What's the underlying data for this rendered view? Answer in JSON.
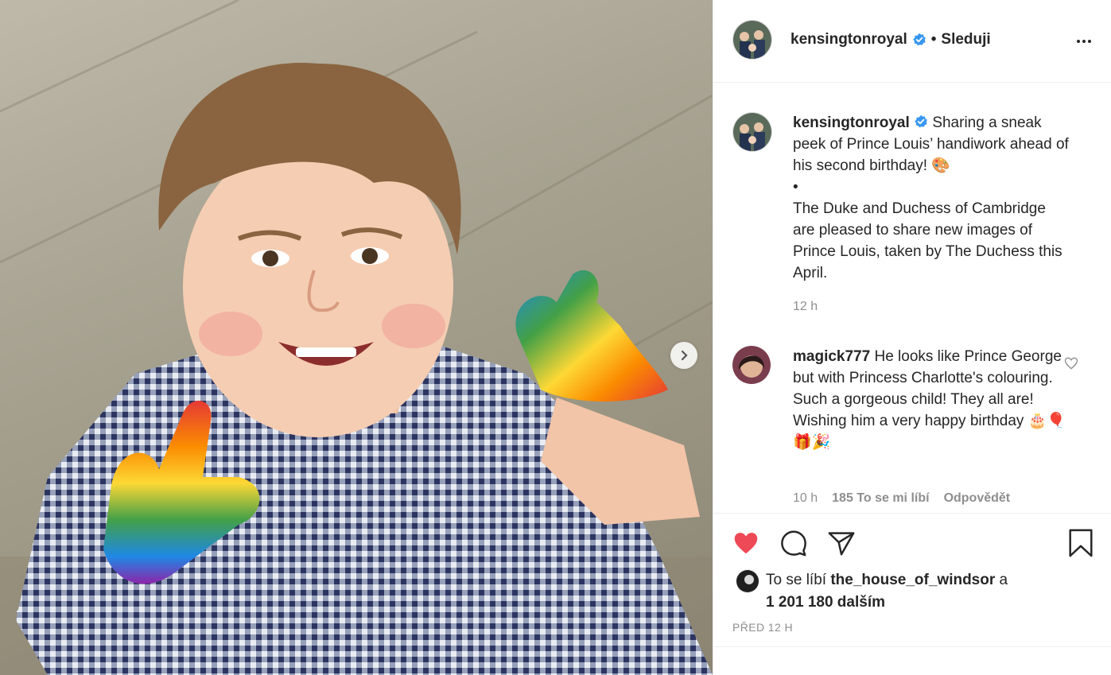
{
  "post": {
    "username": "kensingtonroyal",
    "follow_separator": "•",
    "follow_label": "Sleduji"
  },
  "caption": {
    "username": "kensingtonroyal",
    "line1": "Sharing a sneak peek of Prince Louis’ handiwork ahead of his second birthday! 🎨",
    "bullet": "•",
    "line2": "The Duke and Duchess of Cambridge are pleased to share new images of Prince Louis, taken by The Duchess this April.",
    "time": "12 h"
  },
  "comment": {
    "username": "magick777",
    "text": "He looks like Prince George but with Princess Charlotte's colouring. Such a gorgeous child! They all are! Wishing him a very happy birthday 🎂🎈🎁🎉",
    "time": "10 h",
    "likes": "185 To se mi líbí",
    "reply": "Odpovědět"
  },
  "likes": {
    "prefix": "To se líbí",
    "liker": "the_house_of_windsor",
    "joiner": "a",
    "count": "1 201 180 dalším"
  },
  "posted": "PŘED 12 H",
  "colors": {
    "heart": "#ed4956",
    "verified": "#3897f0",
    "muted": "#8e8e8e"
  }
}
